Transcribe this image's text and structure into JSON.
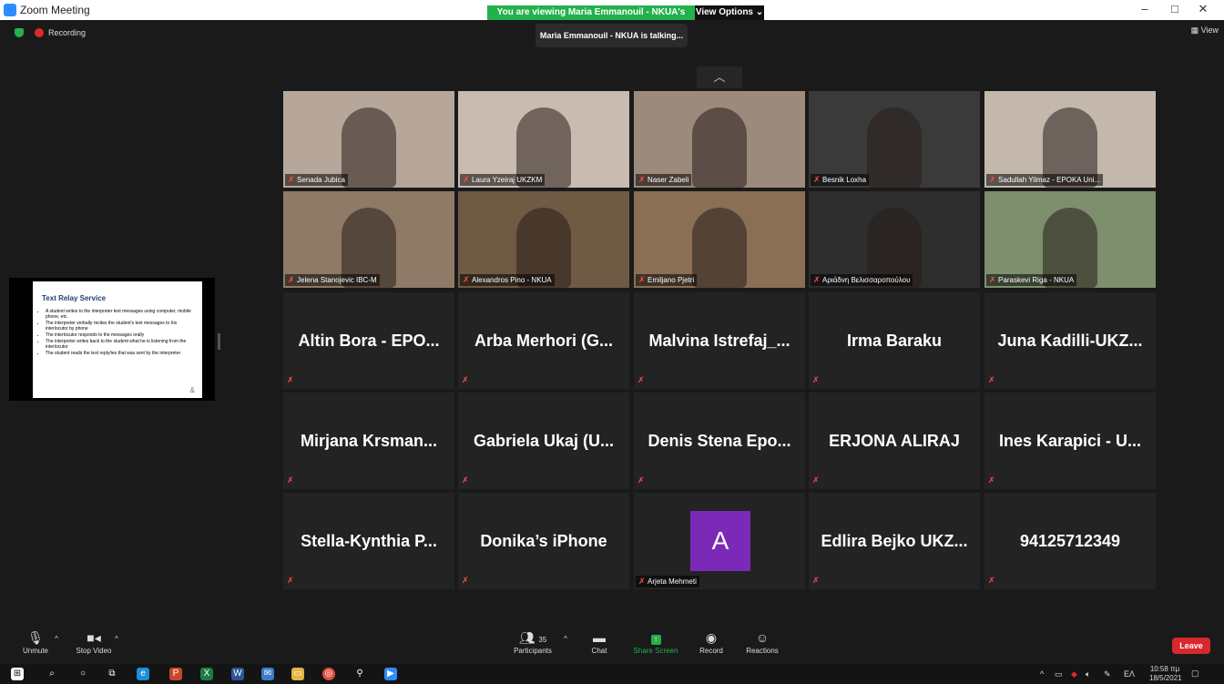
{
  "window": {
    "title": "Zoom Meeting",
    "controls": [
      "–",
      "□",
      "✕"
    ]
  },
  "viewbar": {
    "message": "You are viewing Maria Emmanouil - NKUA's screen",
    "options": "View Options ⌄"
  },
  "status": {
    "recording": "Recording",
    "talking": "Maria Emmanouil - NKUA is talking...",
    "view": "View"
  },
  "colors": {
    "accent_green": "#23b14d",
    "leave_red": "#d6282e",
    "muted_red": "#ff4a4a",
    "avatar_purple": "#7b2ab7"
  },
  "shared_slide": {
    "title": "Text Relay Service",
    "bullets": [
      "A student writes to the interpreter text messages using computer, mobile phone, etc.",
      "The interpreter verbally recites the student's text messages to his interlocutor by phone",
      "The interlocutor responds to the messages orally",
      "The interpreter writes back to the student what he is listening from the interlocutor",
      "The student reads the text reply/ies that was sent by the interpreter"
    ]
  },
  "participants": [
    {
      "name": "Senada Jubica",
      "video": true
    },
    {
      "name": "Laura Yzeiraj UKZKM",
      "video": true
    },
    {
      "name": "Naser Zabeli",
      "video": true
    },
    {
      "name": "Besnik Loxha",
      "video": true
    },
    {
      "name": "Sadullah Yilmaz - EPOKA Uni...",
      "video": true
    },
    {
      "name": "Jelena Stanojevic IBC-M",
      "video": true
    },
    {
      "name": "Alexandros Pino - NKUA",
      "video": true
    },
    {
      "name": "Emiljano Pjetri",
      "video": true
    },
    {
      "name": "Αριάδνη Βελισσαροπούλου",
      "video": true
    },
    {
      "name": "Paraskevi Riga - NKUA",
      "video": true
    },
    {
      "name": "Altin Bora - EPO...",
      "video": false
    },
    {
      "name": "Arba Merhori (G...",
      "video": false
    },
    {
      "name": "Malvina Istrefaj_...",
      "video": false
    },
    {
      "name": "Irma Baraku",
      "video": false
    },
    {
      "name": "Juna Kadilli-UKZ...",
      "video": false
    },
    {
      "name": "Mirjana Krsman...",
      "video": false
    },
    {
      "name": "Gabriela Ukaj (U...",
      "video": false
    },
    {
      "name": "Denis Stena Epo...",
      "video": false
    },
    {
      "name": "ERJONA ALIRAJ",
      "video": false
    },
    {
      "name": "Ines Karapici - U...",
      "video": false
    },
    {
      "name": "Stella-Kynthia P...",
      "video": false
    },
    {
      "name": "Donika’s iPhone",
      "video": false
    },
    {
      "name": "Arjeta Mehmeti",
      "video": false,
      "avatar_letter": "A"
    },
    {
      "name": "Edlira Bejko UKZ...",
      "video": false
    },
    {
      "name": "94125712349",
      "video": false
    }
  ],
  "toolbar": {
    "unmute": "Unmute",
    "stop_video": "Stop Video",
    "participants": "Participants",
    "participant_count": "35",
    "chat": "Chat",
    "share_screen": "Share Screen",
    "record": "Record",
    "reactions": "Reactions",
    "leave": "Leave"
  },
  "tray": {
    "language": "EΛ",
    "time": "10:58 πμ",
    "date": "18/5/2021"
  }
}
